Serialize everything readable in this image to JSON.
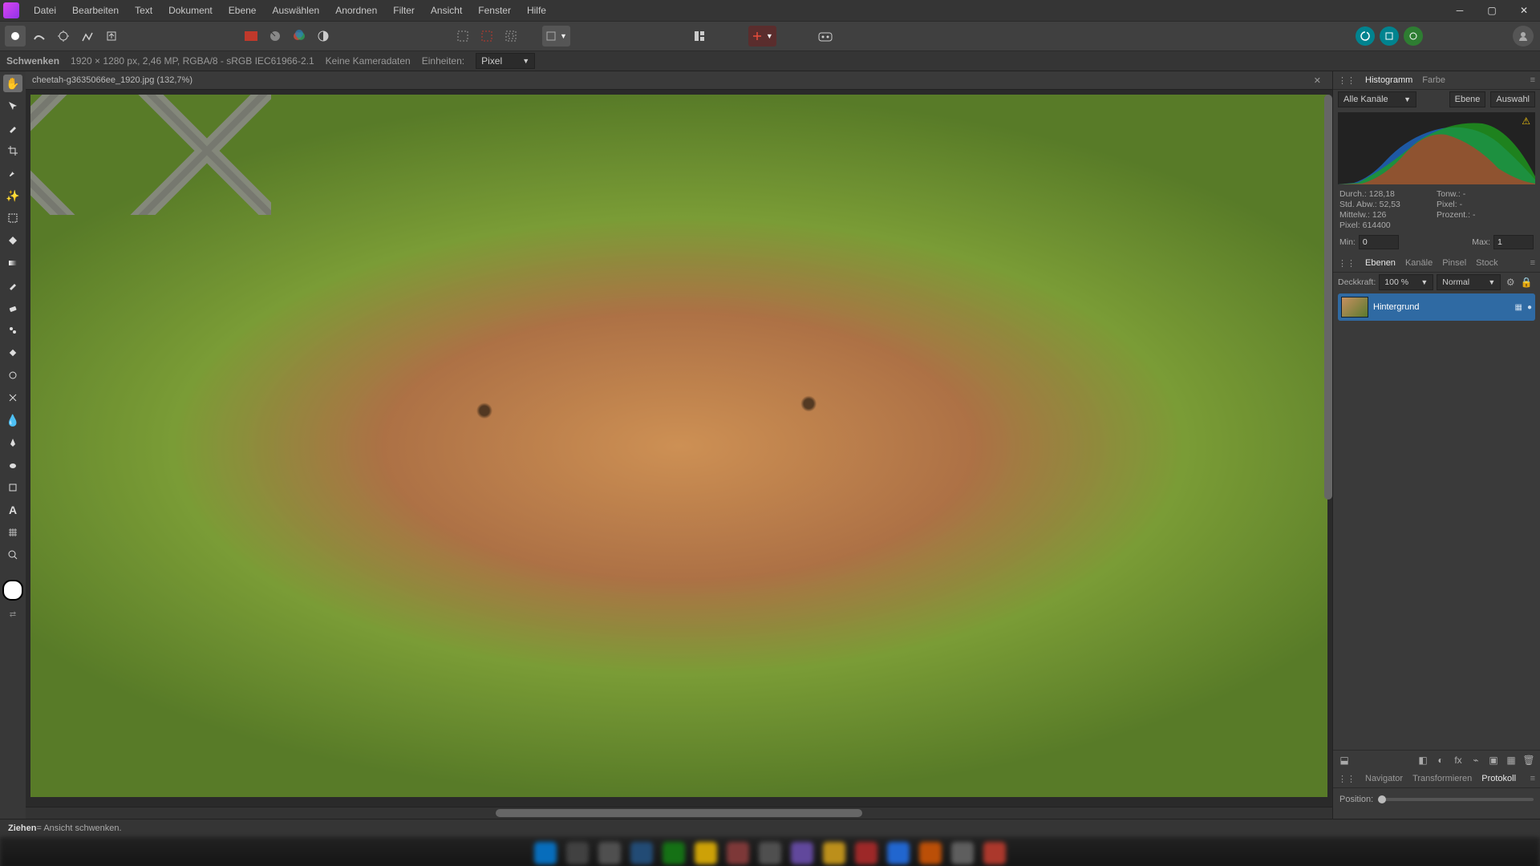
{
  "menubar": {
    "items": [
      "Datei",
      "Bearbeiten",
      "Text",
      "Dokument",
      "Ebene",
      "Auswählen",
      "Anordnen",
      "Filter",
      "Ansicht",
      "Fenster",
      "Hilfe"
    ]
  },
  "context": {
    "tool": "Schwenken",
    "dims": "1920 × 1280 px, 2,46 MP, RGBA/8 - sRGB IEC61966-2.1",
    "camera": "Keine Kameradaten",
    "units_label": "Einheiten:",
    "units_value": "Pixel"
  },
  "document": {
    "tab_title": "cheetah-g3635066ee_1920.jpg (132,7%)"
  },
  "panels": {
    "histogram": {
      "tabs": {
        "hist": "Histogramm",
        "color": "Farbe"
      },
      "channels_label": "Alle Kanäle",
      "buttons": {
        "ebene": "Ebene",
        "auswahl": "Auswahl"
      },
      "stats": {
        "mean_label": "Durch.:",
        "mean": "128,18",
        "std_label": "Std. Abw.:",
        "std": "52,53",
        "median_label": "Mittelw.:",
        "median": "126",
        "pixels_label": "Pixel:",
        "pixels": "614400",
        "tone_label": "Tonw.:",
        "tone": "-",
        "pct_label": "Prozent.:",
        "pct": "-",
        "px_label": "Pixel:",
        "px": "-"
      },
      "range": {
        "min_label": "Min:",
        "min": "0",
        "max_label": "Max:",
        "max": "1"
      }
    },
    "layers": {
      "tabs": {
        "ebenen": "Ebenen",
        "kanale": "Kanäle",
        "pinsel": "Pinsel",
        "stock": "Stock"
      },
      "opacity_label": "Deckkraft:",
      "opacity": "100 %",
      "blend": "Normal",
      "layer0": "Hintergrund"
    },
    "nav": {
      "tabs": {
        "nav": "Navigator",
        "transform": "Transformieren",
        "protocol": "Protokoll"
      },
      "position_label": "Position:"
    }
  },
  "status": {
    "drag": "Ziehen",
    "desc": " = Ansicht schwenken."
  }
}
